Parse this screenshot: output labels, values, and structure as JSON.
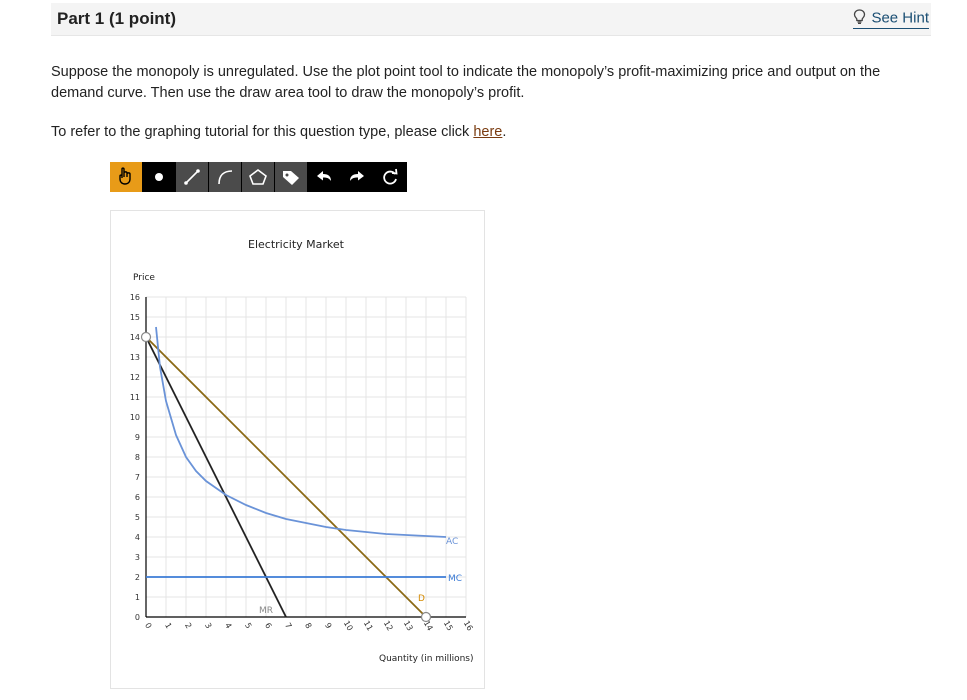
{
  "header": {
    "title": "Part 1   (1 point)",
    "hint_label": "See Hint"
  },
  "question": {
    "text": "Suppose the monopoly is unregulated. Use the plot point tool to indicate the monopoly’s profit-maximizing price and output on the demand curve. Then use the draw area tool to draw the monopoly’s profit.",
    "tutorial_prefix": "To refer to the graphing tutorial for this question type, please click ",
    "tutorial_link": "here",
    "tutorial_suffix": "."
  },
  "toolbar": {
    "tools": [
      "pointer-tool",
      "point-tool",
      "line-tool",
      "curve-tool",
      "area-tool",
      "label-tool",
      "undo-tool",
      "redo-tool",
      "reset-tool"
    ],
    "active": "pointer-tool",
    "accent": "#e89b18"
  },
  "graph": {
    "title": "Electricity Market",
    "ylabel": "Price",
    "xlabel": "Quantity (in millions)",
    "curve_labels": {
      "ac": "AC",
      "mc": "MC",
      "mr": "MR",
      "d": "D"
    }
  },
  "chart_data": {
    "type": "line",
    "title": "Electricity Market",
    "xlabel": "Quantity (in millions)",
    "ylabel": "Price",
    "xlim": [
      0,
      16
    ],
    "ylim": [
      0,
      16
    ],
    "x_ticks": [
      "0",
      "1",
      "2",
      "3",
      "4",
      "5",
      "6",
      "7",
      "8",
      "9",
      "10",
      "11",
      "12",
      "13",
      "14",
      "15",
      "16"
    ],
    "y_ticks": [
      "0",
      "1",
      "2",
      "3",
      "4",
      "5",
      "6",
      "7",
      "8",
      "9",
      "10",
      "11",
      "12",
      "13",
      "14",
      "15",
      "16"
    ],
    "grid": true,
    "series": [
      {
        "name": "D",
        "color": "#8b6914",
        "x": [
          0,
          14
        ],
        "y": [
          14,
          0
        ]
      },
      {
        "name": "MR",
        "color": "#222222",
        "x": [
          0,
          7
        ],
        "y": [
          14,
          0
        ]
      },
      {
        "name": "MC",
        "color": "#3b7bd6",
        "x": [
          0,
          15
        ],
        "y": [
          2,
          2
        ]
      },
      {
        "name": "AC",
        "color": "#6a93d8",
        "x": [
          0.5,
          0.7,
          1,
          1.5,
          2,
          2.5,
          3,
          4,
          5,
          6,
          7,
          8,
          9,
          10,
          11,
          12,
          13,
          14,
          15
        ],
        "y": [
          14.5,
          12.5,
          10.8,
          9.1,
          8.0,
          7.3,
          6.8,
          6.1,
          5.6,
          5.2,
          4.9,
          4.7,
          4.5,
          4.35,
          4.25,
          4.15,
          4.1,
          4.05,
          4.0
        ]
      }
    ],
    "markers": [
      {
        "x": 0,
        "y": 14
      },
      {
        "x": 14,
        "y": 0
      }
    ]
  }
}
